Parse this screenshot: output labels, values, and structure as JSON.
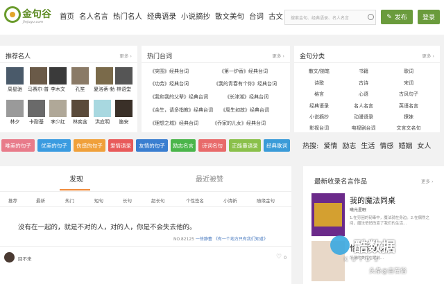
{
  "logo": {
    "text": "金句谷",
    "sub": "Jinjugu.com"
  },
  "nav": [
    "首页",
    "名人名言",
    "热门名人",
    "经典语录",
    "小说摘抄",
    "散文美句",
    "台词",
    "古文",
    "诗"
  ],
  "search": {
    "placeholder": "搜索金句、经典语录、名人名言"
  },
  "buttons": {
    "publish": "发布",
    "login": "登录"
  },
  "people": {
    "title": "推荐名人",
    "more": "更多 ›",
    "items": [
      "周星驰",
      "马赛尔·普",
      "李木文",
      "孔笙",
      "夏洛蒂·勃",
      "林语堂",
      "林夕",
      "卡耐基",
      "李少红",
      "林奕含",
      "洪应明",
      "笛安"
    ]
  },
  "dramas": {
    "title": "热门台词",
    "more": "更多 ›",
    "items": [
      "《突围》经典台词",
      "《第一炉香》经典台词",
      "《功劳》经典台词",
      "《我的青春有个你》经典台词",
      "《我和我的父辈》经典台词",
      "《长津湖》经典台词",
      "《余生，请多指教》经典台词",
      "《周生如故》经典台词",
      "《理想之城》经典台词",
      "《乔家的儿女》经典台词"
    ]
  },
  "categories": {
    "title": "金句分类",
    "more": "更多 ›",
    "items": [
      "散文/随笔",
      "书籍",
      "歌词",
      "诗歌",
      "古诗",
      "宋词",
      "格言",
      "心语",
      "古风句子",
      "经典语录",
      "名人名言",
      "英语名言",
      "小说摘抄",
      "动漫语录",
      "撩妹",
      "影视台词",
      "电视剧台词",
      "文言文名句"
    ]
  },
  "tags": [
    "唯美的句子",
    "优美的句子",
    "伤感的句子",
    "爱情语录",
    "友情的句子",
    "励志名言",
    "诗词名句",
    "正能量语录",
    "经典歌词"
  ],
  "hot": {
    "label": "热搜:",
    "items": [
      "爱情",
      "励志",
      "生活",
      "情感",
      "婚姻",
      "女人"
    ]
  },
  "feed": {
    "tabs": [
      "发现",
      "最近被赞"
    ],
    "subtabs": [
      "推荐",
      "最新",
      "热门",
      "短句",
      "长句",
      "超长句",
      "个性签名",
      "小清新",
      "随缘金句"
    ],
    "quote": "没有在一起的，就是不对的人，对的人，你是不会失去他的。",
    "no": "NO.82125",
    "author": "一徐静蕾",
    "source": "《有一个地方只有我们知道》",
    "user": "回不来",
    "likes": "0"
  },
  "latest": {
    "title": "最新收录名言作品",
    "more": "更多 ›",
    "book1": {
      "title": "我的魔法同桌",
      "author": "曦光星眠",
      "snippet": "1.在穷困的韧毒中，魔法就在身边。2.在偶然之间，魔法悄悄改变了我们的生活..."
    },
    "book2": {
      "title": "恰如你的人生",
      "snippet": "所谓的美好在眼前..."
    }
  },
  "watermark": {
    "brand": "酷数据",
    "sub": "KUIDS",
    "author": "头条@吉石俗"
  }
}
